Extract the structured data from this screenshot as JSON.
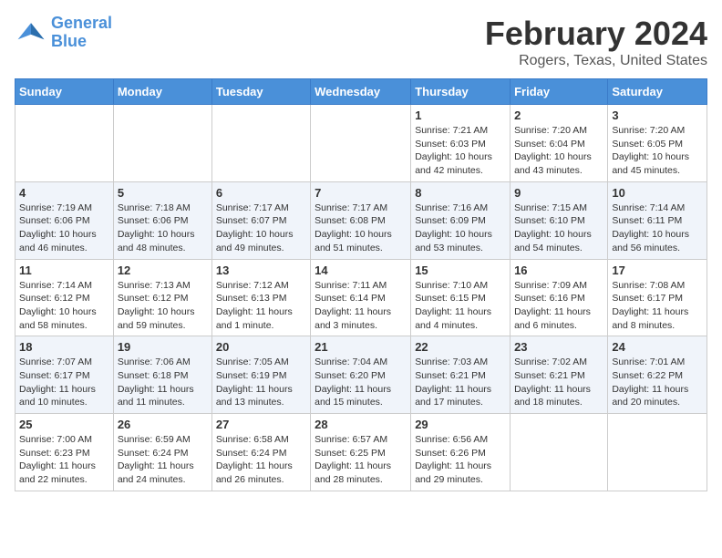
{
  "header": {
    "logo_line1": "General",
    "logo_line2": "Blue",
    "title": "February 2024",
    "subtitle": "Rogers, Texas, United States"
  },
  "days_of_week": [
    "Sunday",
    "Monday",
    "Tuesday",
    "Wednesday",
    "Thursday",
    "Friday",
    "Saturday"
  ],
  "weeks": [
    [
      {
        "num": "",
        "detail": ""
      },
      {
        "num": "",
        "detail": ""
      },
      {
        "num": "",
        "detail": ""
      },
      {
        "num": "",
        "detail": ""
      },
      {
        "num": "1",
        "detail": "Sunrise: 7:21 AM\nSunset: 6:03 PM\nDaylight: 10 hours\nand 42 minutes."
      },
      {
        "num": "2",
        "detail": "Sunrise: 7:20 AM\nSunset: 6:04 PM\nDaylight: 10 hours\nand 43 minutes."
      },
      {
        "num": "3",
        "detail": "Sunrise: 7:20 AM\nSunset: 6:05 PM\nDaylight: 10 hours\nand 45 minutes."
      }
    ],
    [
      {
        "num": "4",
        "detail": "Sunrise: 7:19 AM\nSunset: 6:06 PM\nDaylight: 10 hours\nand 46 minutes."
      },
      {
        "num": "5",
        "detail": "Sunrise: 7:18 AM\nSunset: 6:06 PM\nDaylight: 10 hours\nand 48 minutes."
      },
      {
        "num": "6",
        "detail": "Sunrise: 7:17 AM\nSunset: 6:07 PM\nDaylight: 10 hours\nand 49 minutes."
      },
      {
        "num": "7",
        "detail": "Sunrise: 7:17 AM\nSunset: 6:08 PM\nDaylight: 10 hours\nand 51 minutes."
      },
      {
        "num": "8",
        "detail": "Sunrise: 7:16 AM\nSunset: 6:09 PM\nDaylight: 10 hours\nand 53 minutes."
      },
      {
        "num": "9",
        "detail": "Sunrise: 7:15 AM\nSunset: 6:10 PM\nDaylight: 10 hours\nand 54 minutes."
      },
      {
        "num": "10",
        "detail": "Sunrise: 7:14 AM\nSunset: 6:11 PM\nDaylight: 10 hours\nand 56 minutes."
      }
    ],
    [
      {
        "num": "11",
        "detail": "Sunrise: 7:14 AM\nSunset: 6:12 PM\nDaylight: 10 hours\nand 58 minutes."
      },
      {
        "num": "12",
        "detail": "Sunrise: 7:13 AM\nSunset: 6:12 PM\nDaylight: 10 hours\nand 59 minutes."
      },
      {
        "num": "13",
        "detail": "Sunrise: 7:12 AM\nSunset: 6:13 PM\nDaylight: 11 hours\nand 1 minute."
      },
      {
        "num": "14",
        "detail": "Sunrise: 7:11 AM\nSunset: 6:14 PM\nDaylight: 11 hours\nand 3 minutes."
      },
      {
        "num": "15",
        "detail": "Sunrise: 7:10 AM\nSunset: 6:15 PM\nDaylight: 11 hours\nand 4 minutes."
      },
      {
        "num": "16",
        "detail": "Sunrise: 7:09 AM\nSunset: 6:16 PM\nDaylight: 11 hours\nand 6 minutes."
      },
      {
        "num": "17",
        "detail": "Sunrise: 7:08 AM\nSunset: 6:17 PM\nDaylight: 11 hours\nand 8 minutes."
      }
    ],
    [
      {
        "num": "18",
        "detail": "Sunrise: 7:07 AM\nSunset: 6:17 PM\nDaylight: 11 hours\nand 10 minutes."
      },
      {
        "num": "19",
        "detail": "Sunrise: 7:06 AM\nSunset: 6:18 PM\nDaylight: 11 hours\nand 11 minutes."
      },
      {
        "num": "20",
        "detail": "Sunrise: 7:05 AM\nSunset: 6:19 PM\nDaylight: 11 hours\nand 13 minutes."
      },
      {
        "num": "21",
        "detail": "Sunrise: 7:04 AM\nSunset: 6:20 PM\nDaylight: 11 hours\nand 15 minutes."
      },
      {
        "num": "22",
        "detail": "Sunrise: 7:03 AM\nSunset: 6:21 PM\nDaylight: 11 hours\nand 17 minutes."
      },
      {
        "num": "23",
        "detail": "Sunrise: 7:02 AM\nSunset: 6:21 PM\nDaylight: 11 hours\nand 18 minutes."
      },
      {
        "num": "24",
        "detail": "Sunrise: 7:01 AM\nSunset: 6:22 PM\nDaylight: 11 hours\nand 20 minutes."
      }
    ],
    [
      {
        "num": "25",
        "detail": "Sunrise: 7:00 AM\nSunset: 6:23 PM\nDaylight: 11 hours\nand 22 minutes."
      },
      {
        "num": "26",
        "detail": "Sunrise: 6:59 AM\nSunset: 6:24 PM\nDaylight: 11 hours\nand 24 minutes."
      },
      {
        "num": "27",
        "detail": "Sunrise: 6:58 AM\nSunset: 6:24 PM\nDaylight: 11 hours\nand 26 minutes."
      },
      {
        "num": "28",
        "detail": "Sunrise: 6:57 AM\nSunset: 6:25 PM\nDaylight: 11 hours\nand 28 minutes."
      },
      {
        "num": "29",
        "detail": "Sunrise: 6:56 AM\nSunset: 6:26 PM\nDaylight: 11 hours\nand 29 minutes."
      },
      {
        "num": "",
        "detail": ""
      },
      {
        "num": "",
        "detail": ""
      }
    ]
  ]
}
